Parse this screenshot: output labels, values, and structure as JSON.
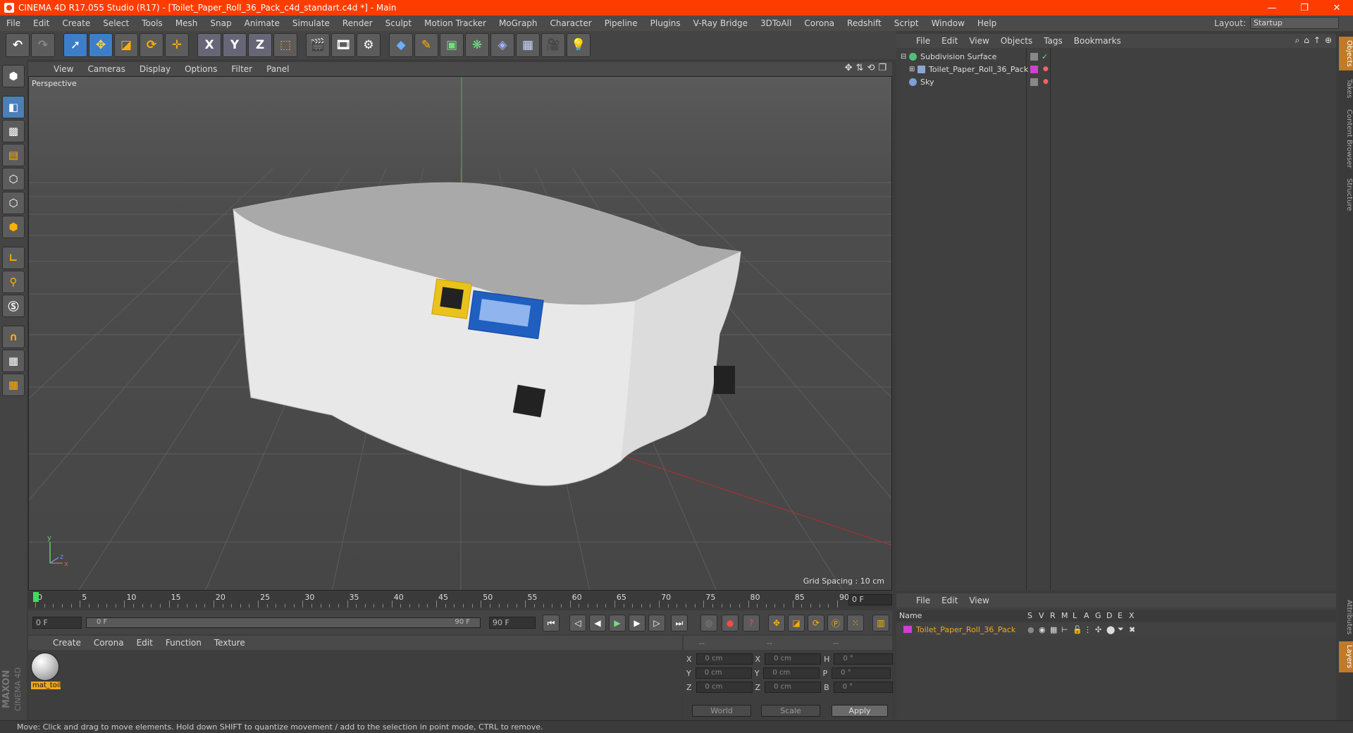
{
  "window": {
    "title": "CINEMA 4D R17.055 Studio (R17) - [Toilet_Paper_Roll_36_Pack_c4d_standart.c4d *] - Main",
    "controls": [
      "—",
      "❐",
      "✕"
    ]
  },
  "menubar": {
    "items": [
      "File",
      "Edit",
      "Create",
      "Select",
      "Tools",
      "Mesh",
      "Snap",
      "Animate",
      "Simulate",
      "Render",
      "Sculpt",
      "Motion Tracker",
      "MoGraph",
      "Character",
      "Pipeline",
      "Plugins",
      "V-Ray Bridge",
      "3DToAll",
      "Corona",
      "Redshift",
      "Script",
      "Window",
      "Help"
    ],
    "layout_label": "Layout:",
    "layout_value": "Startup"
  },
  "toolbar": {
    "axis_x": "X",
    "axis_y": "Y",
    "axis_z": "Z"
  },
  "viewport": {
    "menu": [
      "View",
      "Cameras",
      "Display",
      "Options",
      "Filter",
      "Panel"
    ],
    "label": "Perspective",
    "grid_spacing": "Grid Spacing : 10 cm",
    "axis_y": "y",
    "axis_z": "z",
    "axis_x": "x"
  },
  "timeline": {
    "ticks": [
      "0",
      "5",
      "10",
      "15",
      "20",
      "25",
      "30",
      "35",
      "40",
      "45",
      "50",
      "55",
      "60",
      "65",
      "70",
      "75",
      "80",
      "85",
      "90"
    ],
    "current_frame": "0 F"
  },
  "transport": {
    "start_field": "0 F",
    "slider_start": "0 F",
    "slider_end": "90 F",
    "end_field": "90 F"
  },
  "material_panel": {
    "menu": [
      "Create",
      "Corona",
      "Edit",
      "Function",
      "Texture"
    ],
    "material_name": "mat_toil"
  },
  "coordinates": {
    "headers": [
      "--",
      "--",
      "--"
    ],
    "rows": [
      {
        "a": "X",
        "av": "0 cm",
        "b": "X",
        "bv": "0 cm",
        "c": "H",
        "cv": "0 °"
      },
      {
        "a": "Y",
        "av": "0 cm",
        "b": "Y",
        "bv": "0 cm",
        "c": "P",
        "cv": "0 °"
      },
      {
        "a": "Z",
        "av": "0 cm",
        "b": "Z",
        "bv": "0 cm",
        "c": "B",
        "cv": "0 °"
      }
    ],
    "world": "World",
    "scale": "Scale",
    "apply": "Apply"
  },
  "status": {
    "text": "Move: Click and drag to move elements. Hold down SHIFT to quantize movement / add to the selection in point mode, CTRL to remove."
  },
  "object_manager": {
    "menu": [
      "File",
      "Edit",
      "View",
      "Objects",
      "Tags",
      "Bookmarks"
    ],
    "objects": [
      {
        "name": "Subdivision Surface",
        "icon_color": "#4fc07a"
      },
      {
        "name": "Toilet_Paper_Roll_36_Pack",
        "icon_color": "#8aa6d6"
      },
      {
        "name": "Sky",
        "icon_color": "#7aa0d8"
      }
    ]
  },
  "layer_manager": {
    "menu": [
      "File",
      "Edit",
      "View"
    ],
    "header_name": "Name",
    "columns": [
      "S",
      "V",
      "R",
      "M",
      "L",
      "A",
      "G",
      "D",
      "E",
      "X"
    ],
    "layer_name": "Toilet_Paper_Roll_36_Pack",
    "layer_color": "#d040d0"
  },
  "right_tabs": [
    "Objects",
    "Takes",
    "Content Browser",
    "Structure",
    "Attributes",
    "Layers"
  ],
  "branding": {
    "maxon": "MAXON",
    "cinema": "CINEMA 4D"
  },
  "colors": {
    "titlebar": "#ff3c00",
    "accent_blue": "#3c7fc8",
    "highlight": "#f5a623"
  }
}
